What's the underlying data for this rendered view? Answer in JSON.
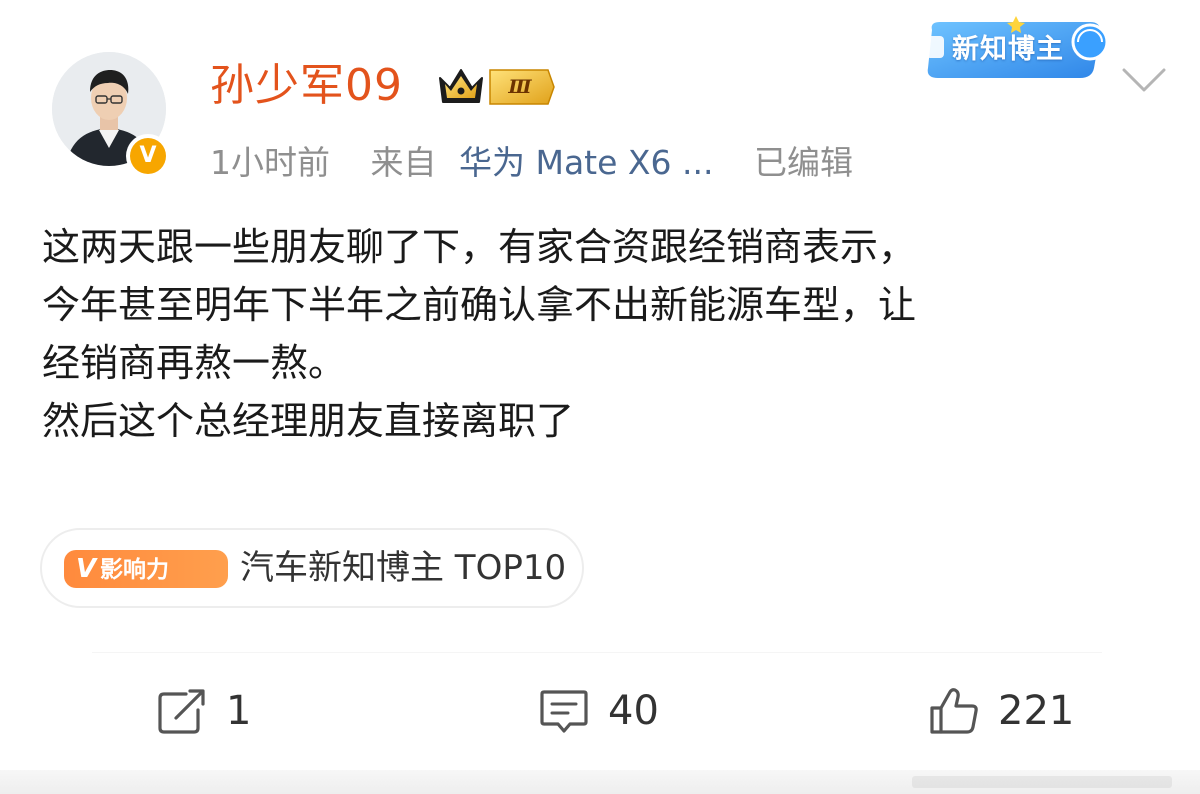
{
  "post": {
    "author": {
      "name": "孙少军09",
      "level": "Ⅲ",
      "verified_mark": "V"
    },
    "meta": {
      "time": "1小时前",
      "from_label": "来自",
      "device": "华为 Mate X6 ...",
      "edited": "已编辑"
    },
    "badge": {
      "label": "新知博主"
    },
    "text_lines": [
      "这两天跟一些朋友聊了下，有家合资跟经销商表示，",
      "今年甚至明年下半年之前确认拿不出新能源车型，让",
      "经销商再熬一熬。",
      "然后这个总经理朋友直接离职了"
    ],
    "influence": {
      "pill_v": "V",
      "pill_text": "影响力",
      "label": "汽车新知博主 TOP10"
    },
    "actions": {
      "repost": {
        "icon": "share-icon",
        "count": "1"
      },
      "comment": {
        "icon": "comment-icon",
        "count": "40"
      },
      "like": {
        "icon": "thumbs-up-icon",
        "count": "221"
      }
    }
  },
  "colors": {
    "username": "#e3531c",
    "device_link": "#4a6790",
    "meta_gray": "#8f8f8f",
    "influence_orange": "#ff8a3d",
    "verified_gold": "#f7a600"
  }
}
